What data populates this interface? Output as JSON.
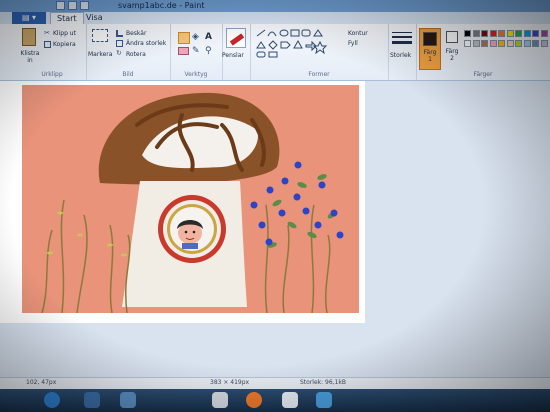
{
  "window": {
    "title": "svamp1abc.de - Paint"
  },
  "tabs": {
    "file": "",
    "start": "Start",
    "view": "Visa"
  },
  "clipboard": {
    "paste": "Klistra in",
    "cut": "Klipp ut",
    "copy": "Kopiera",
    "group": "Urklipp"
  },
  "image": {
    "select": "Markera",
    "crop": "Beskär",
    "resize": "Ändra storlek",
    "rotate": "Rotera",
    "group": "Bild"
  },
  "tools": {
    "group": "Verktyg"
  },
  "brushes": {
    "label": "Penslar"
  },
  "shapes": {
    "outline": "Kontur",
    "fill": "Fyll",
    "group": "Former"
  },
  "size": {
    "label": "Storlek"
  },
  "colors": {
    "color1": "Färg 1",
    "color2": "Färg 2",
    "group": "Färger",
    "palette": [
      "#000000",
      "#7f7f7f",
      "#880015",
      "#ed1c24",
      "#ff7f27",
      "#fff200",
      "#22b14c",
      "#00a2e8",
      "#3f48cc",
      "#a349a4",
      "#ffffff",
      "#c3c3c3",
      "#b97a57",
      "#ffaec9",
      "#ffc90e",
      "#efe4b0",
      "#b5e61d",
      "#99d9ea",
      "#7092be",
      "#c8bfe7"
    ],
    "active1": "#2a1a0e",
    "active2": "#ffffff"
  },
  "status": {
    "position": "102, 47px",
    "dimensions": "383 × 419px",
    "filesize": "Storlek: 96,1kB"
  }
}
